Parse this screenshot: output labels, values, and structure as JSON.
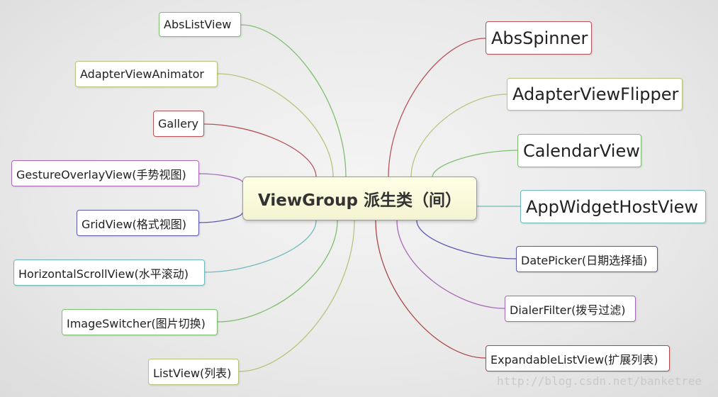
{
  "colors": {
    "green": "#8ec07c",
    "olive": "#b7c47a",
    "red": "#b4555a",
    "purple": "#a868b8",
    "indigo": "#5a57b0",
    "teal": "#6fb8bc",
    "dark_red": "#a84848",
    "center_fill": "#fbfbdc"
  },
  "center": {
    "label": "ViewGroup 派生类（间）"
  },
  "left_nodes": [
    {
      "label": "AbsListView",
      "color": "#7fbf70"
    },
    {
      "label": "AdapterViewAnimator",
      "color": "#b7c47a"
    },
    {
      "label": "Gallery",
      "color": "#b4555a"
    },
    {
      "label": "GestureOverlayView(手势视图)",
      "color": "#a868b8"
    },
    {
      "label": "GridView(格式视图)",
      "color": "#5a57b0"
    },
    {
      "label": "HorizontalScrollView(水平滚动)",
      "color": "#6fb8bc"
    },
    {
      "label": "ImageSwitcher(图片切换)",
      "color": "#7fbf70"
    },
    {
      "label": "ListView(列表)",
      "color": "#b7c47a"
    }
  ],
  "right_nodes": [
    {
      "label": "AbsSpinner",
      "color": "#b4555a"
    },
    {
      "label": "AdapterViewFlipper",
      "color": "#b7c47a"
    },
    {
      "label": "CalendarView",
      "color": "#7fbf70"
    },
    {
      "label": "AppWidgetHostView",
      "color": "#6fb8bc"
    },
    {
      "label": "DatePicker(日期选择插)",
      "color": "#5a57b0"
    },
    {
      "label": "DialerFilter(拨号过滤)",
      "color": "#a868b8"
    },
    {
      "label": "ExpandableListView(扩展列表)",
      "color": "#a84848"
    }
  ],
  "watermark": "http://blog.csdn.net/banketree"
}
